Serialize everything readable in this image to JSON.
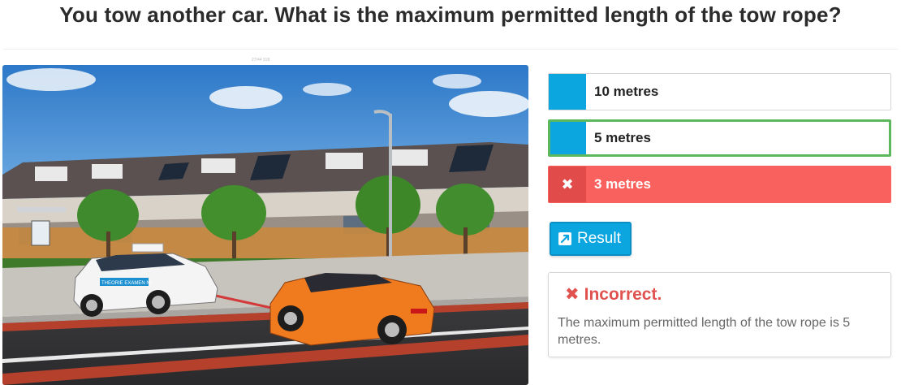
{
  "question": {
    "title": "You tow another car. What is the maximum permitted length of the tow rope?",
    "image_caption": "27/44 318"
  },
  "scene": {
    "car_sign": "THEORIE EXAMEN NL"
  },
  "answers": [
    {
      "label": "10 metres",
      "state": "default"
    },
    {
      "label": "5 metres",
      "state": "correct"
    },
    {
      "label": "3 metres",
      "state": "selected-wrong",
      "mark": "✖"
    }
  ],
  "result_button": {
    "label": "Result",
    "icon": "external-link-icon"
  },
  "feedback": {
    "mark": "✖",
    "heading": "Incorrect.",
    "text": "The maximum permitted length of the tow rope is 5 metres."
  },
  "colors": {
    "accent": "#0ba5e0",
    "correct_border": "#5cb85c",
    "wrong_bg": "#f9615e",
    "feedback_heading": "#e0524f"
  }
}
